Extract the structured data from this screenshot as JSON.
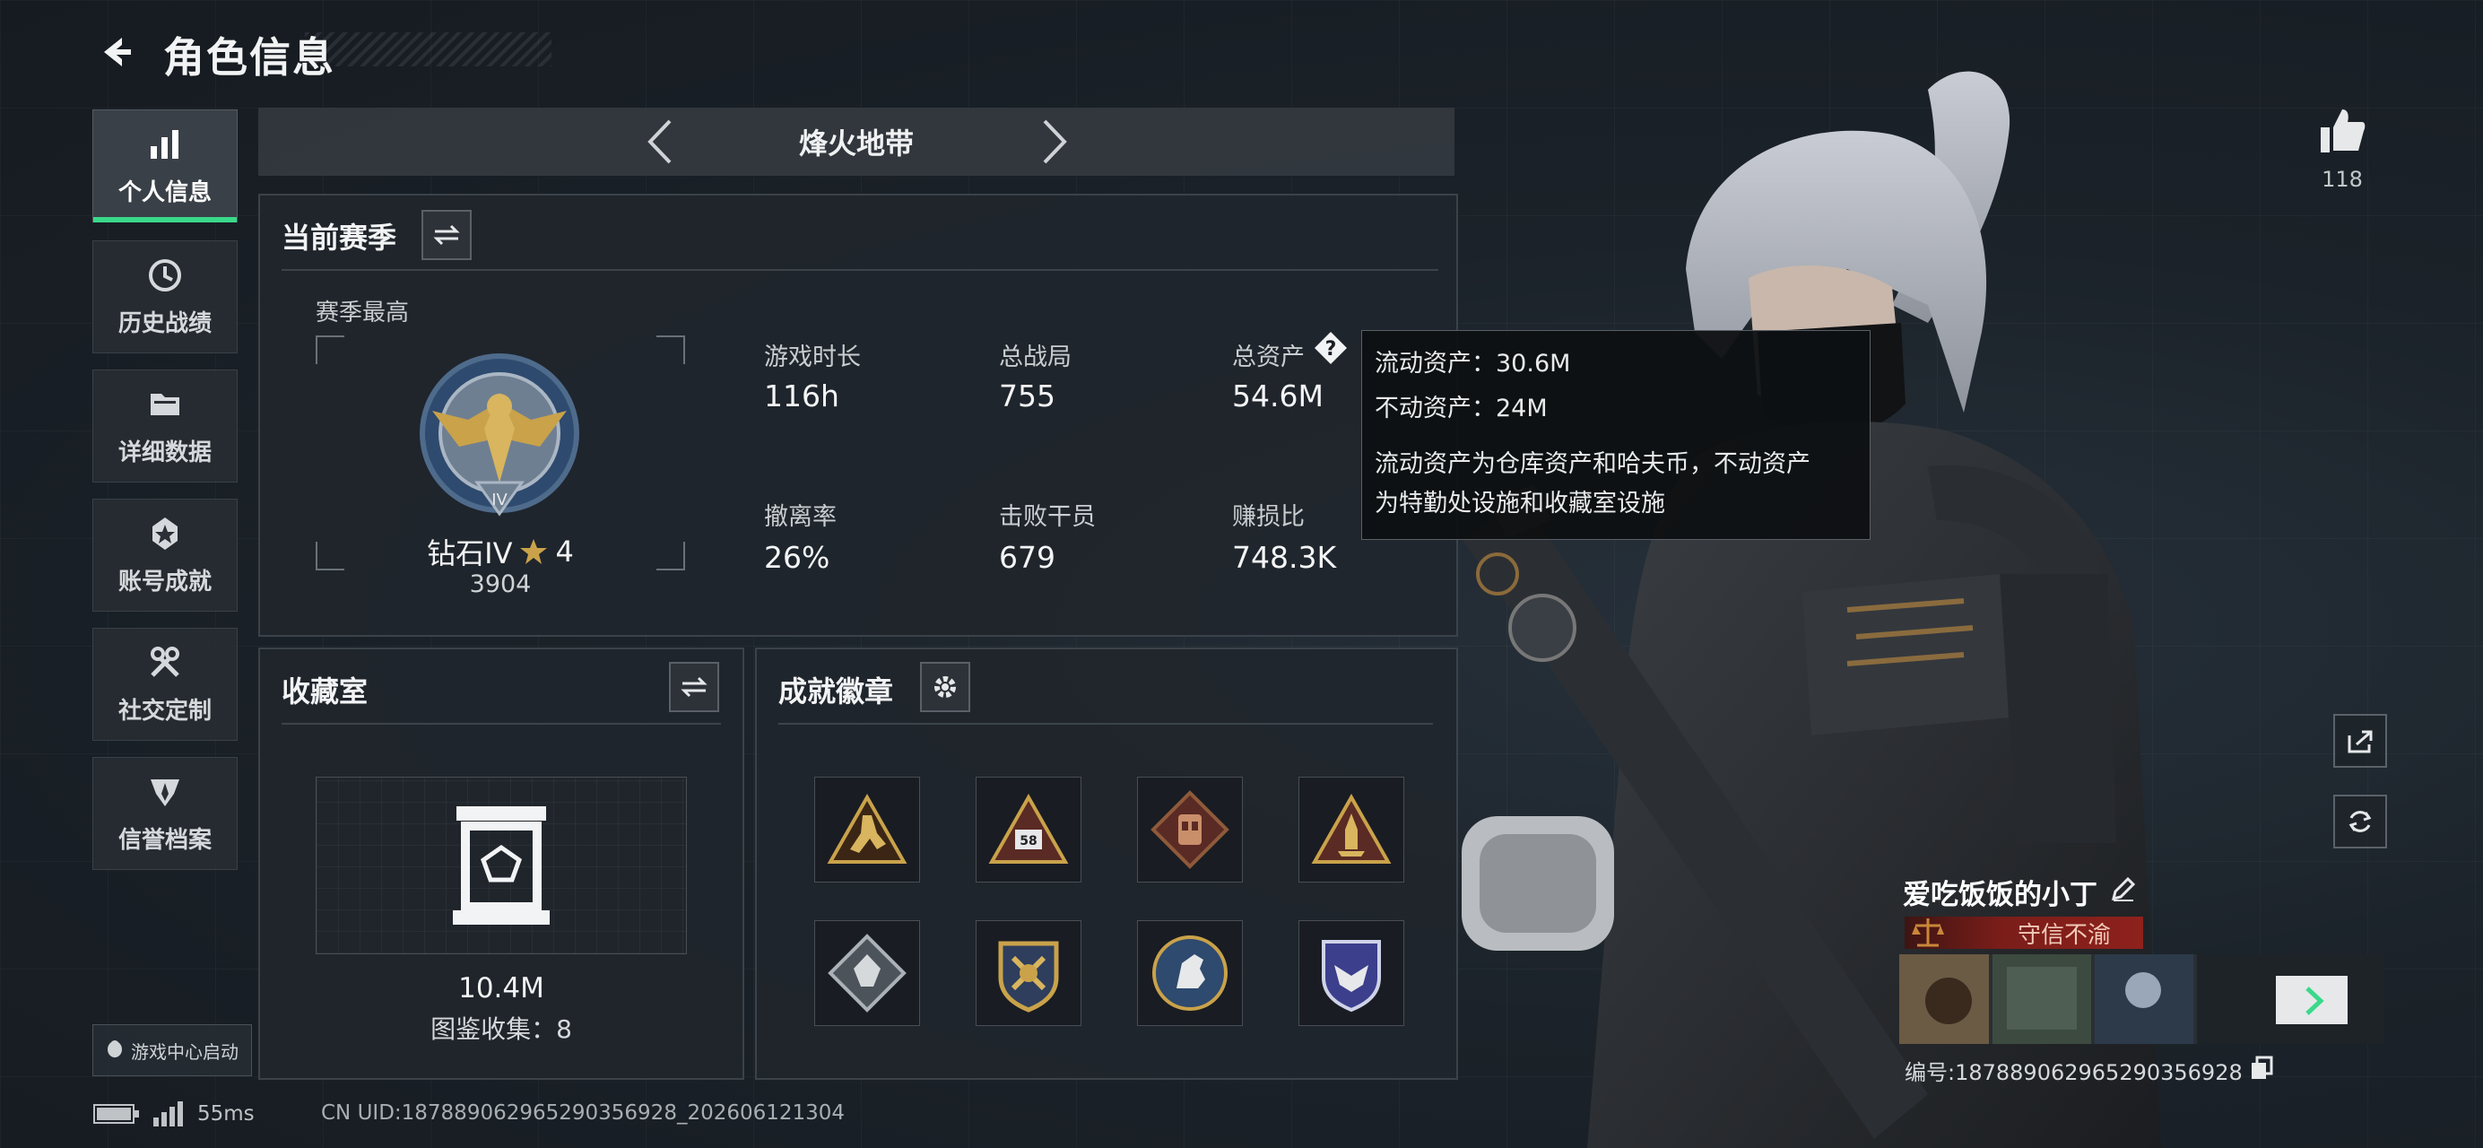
{
  "header": {
    "title": "角色信息"
  },
  "sidebar": {
    "items": [
      {
        "label": "个人信息",
        "active": true,
        "icon": "bar-chart-icon"
      },
      {
        "label": "历史战绩",
        "active": false,
        "icon": "clock-icon"
      },
      {
        "label": "详细数据",
        "active": false,
        "icon": "folder-icon"
      },
      {
        "label": "账号成就",
        "active": false,
        "icon": "medal-icon"
      },
      {
        "label": "社交定制",
        "active": false,
        "icon": "tools-icon"
      },
      {
        "label": "信誉档案",
        "active": false,
        "icon": "shield-icon"
      }
    ],
    "launch_label": "游戏中心启动"
  },
  "mode_selector": {
    "name": "烽火地带"
  },
  "current_season": {
    "title": "当前赛季",
    "best_label": "赛季最高",
    "rank_name": "钻石IV",
    "stars": "4",
    "rank_points": "3904",
    "stats": [
      {
        "label": "游戏时长",
        "value": "116h"
      },
      {
        "label": "总战局",
        "value": "755"
      },
      {
        "label": "总资产",
        "value": "54.6M"
      },
      {
        "label": "撤离率",
        "value": "26%"
      },
      {
        "label": "击败干员",
        "value": "679"
      },
      {
        "label": "赚损比",
        "value": "748.3K"
      }
    ]
  },
  "tooltip": {
    "line1": "流动资产：30.6M",
    "line2": "不动资产：24M",
    "line3": "流动资产为仓库资产和哈夫币，不动资产",
    "line4": "为特勤处设施和收藏室设施"
  },
  "collection": {
    "title": "收藏室",
    "value": "10.4M",
    "catalog": "图鉴收集：8"
  },
  "badges": {
    "title": "成就徽章",
    "items": [
      "badge-gold-figure-icon",
      "badge-58-icon",
      "badge-vest-icon",
      "badge-rocket-icon",
      "badge-diamond-icon",
      "badge-crossed-swords-icon",
      "badge-horse-icon",
      "badge-eagle-shield-icon"
    ],
    "badge_58_text": "58"
  },
  "player": {
    "name": "爱吃饭饭的小丁",
    "honor": "守信不渝",
    "uid": "编号:18788906296529035692​8",
    "likes": "118"
  },
  "footer": {
    "ping": "55ms",
    "cn_uid": "CN UID:18788906296529035692​8_202606121304"
  },
  "colors": {
    "accent_green": "#39d98a",
    "honor_red": "#8e211c",
    "gold": "#c9a24a"
  }
}
